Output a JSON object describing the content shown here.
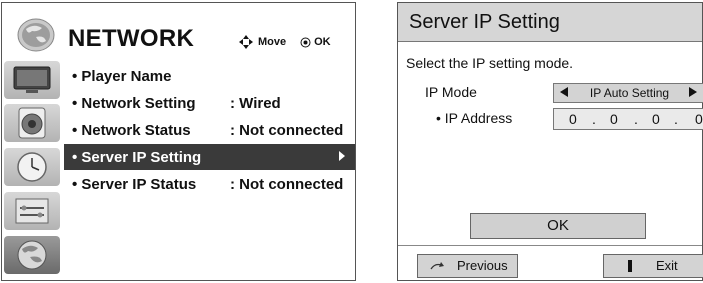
{
  "network_menu": {
    "title": "NETWORK",
    "hint_move": "Move",
    "hint_ok": "OK",
    "sidebar_icons": [
      "tv-icon",
      "speaker-icon",
      "clock-icon",
      "toolbox-icon",
      "globe-icon"
    ],
    "active_icon": "globe-icon",
    "items": [
      {
        "label": "• Player Name",
        "value": ""
      },
      {
        "label": "• Network Setting",
        "value": ": Wired"
      },
      {
        "label": "• Network Status",
        "value": ": Not connected"
      },
      {
        "label": "• Server IP Setting",
        "value": "",
        "selected": true
      },
      {
        "label": "• Server IP Status",
        "value": ": Not connected"
      }
    ]
  },
  "server_ip_dialog": {
    "title": "Server IP Setting",
    "description": "Select the IP setting mode.",
    "ip_mode_label": "IP Mode",
    "ip_mode_value": "IP Auto Setting",
    "ip_address_label": "• IP Address",
    "ip_octets": [
      "0",
      "0",
      "0",
      "0"
    ],
    "ok_label": "OK",
    "previous_label": "Previous",
    "exit_label": "Exit"
  },
  "colors": {
    "selected_row_bg": "#3a3a3a",
    "title_bar_bg": "#d6d6d6",
    "button_bg": "#d0d0d0"
  }
}
